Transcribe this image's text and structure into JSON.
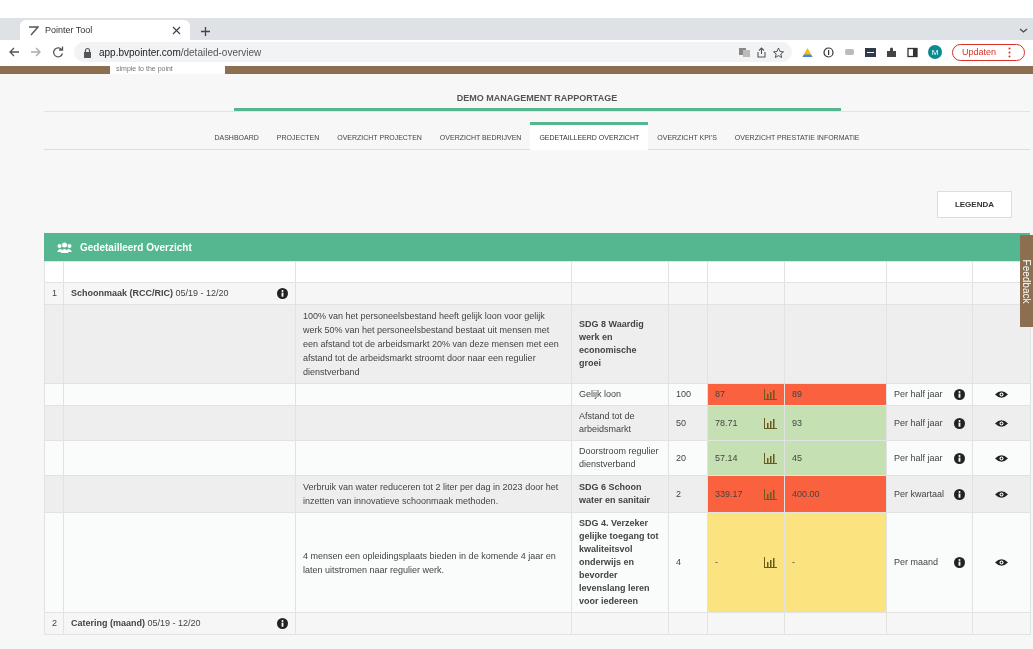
{
  "browser": {
    "tab": {
      "title": "Pointer Tool"
    },
    "url": {
      "host": "app.bvpointer.com",
      "path": "/detailed-overview"
    },
    "profile": "M",
    "update_button": "Updaten"
  },
  "site": {
    "logo_tagline": "simple to the point",
    "title": "DEMO MANAGEMENT RAPPORTAGE",
    "nav": [
      {
        "label": "DASHBOARD",
        "selected": false
      },
      {
        "label": "PROJECTEN",
        "selected": false
      },
      {
        "label": "OVERZICHT PROJECTEN",
        "selected": false
      },
      {
        "label": "OVERZICHT BEDRIJVEN",
        "selected": false
      },
      {
        "label": "GEDETAILLEERD OVERZICHT",
        "selected": true
      },
      {
        "label": "OVERZICHT KPI'S",
        "selected": false
      },
      {
        "label": "OVERZICHT PRESTATIE INFORMATIE",
        "selected": false
      }
    ],
    "legend_button": "LEGENDA",
    "feedback_tab": "Feedback"
  },
  "panel": {
    "title": "Gedetailleerd Overzicht",
    "rows": [
      {
        "kind": "project",
        "number": "1",
        "name": "Schoonmaak (RCC/RIC)",
        "period": "05/19 - 12/20"
      },
      {
        "kind": "goal",
        "description": "100% van het personeelsbestand heeft gelijk loon voor gelijk werk 50% van het personeelsbestand bestaat uit mensen met een afstand tot de arbeidsmarkt 20% van deze mensen met een afstand tot de arbeidsmarkt stroomt door naar een regulier dienstverband",
        "sdg": "SDG 8 Waardig werk en economische groei"
      },
      {
        "kind": "kpi",
        "indicator": "Gelijk loon",
        "target": "100",
        "score": "87",
        "previous": "89",
        "color": "#f9613f",
        "frequency": "Per half jaar"
      },
      {
        "kind": "kpi",
        "indicator": "Afstand tot de arbeidsmarkt",
        "target": "50",
        "score": "78.71",
        "previous": "93",
        "color": "#c5e0b3",
        "frequency": "Per half jaar"
      },
      {
        "kind": "kpi",
        "indicator": "Doorstroom regulier dienstverband",
        "target": "20",
        "score": "57.14",
        "previous": "45",
        "color": "#c5e0b3",
        "frequency": "Per half jaar"
      },
      {
        "kind": "goal",
        "description": "Verbruik van water reduceren tot 2 liter per dag in 2023 door het inzetten van innovatieve schoonmaak methoden.",
        "sdg": "SDG 6 Schoon water en sanitair",
        "target": "2",
        "score": "339.17",
        "previous": "400.00",
        "color": "#f9613f",
        "frequency": "Per kwartaal"
      },
      {
        "kind": "goal",
        "description": "4 mensen een opleidingsplaats bieden in de komende 4 jaar en laten uitstromen naar regulier werk.",
        "sdg": "SDG 4. Verzeker gelijke toegang tot kwaliteitsvol onderwijs en bevorder levenslang leren voor iedereen",
        "target": "4",
        "score": "-",
        "previous": "-",
        "color": "#fbe47f",
        "frequency": "Per maand"
      },
      {
        "kind": "project",
        "number": "2",
        "name": "Catering (maand)",
        "period": "05/19 - 12/20"
      }
    ]
  }
}
